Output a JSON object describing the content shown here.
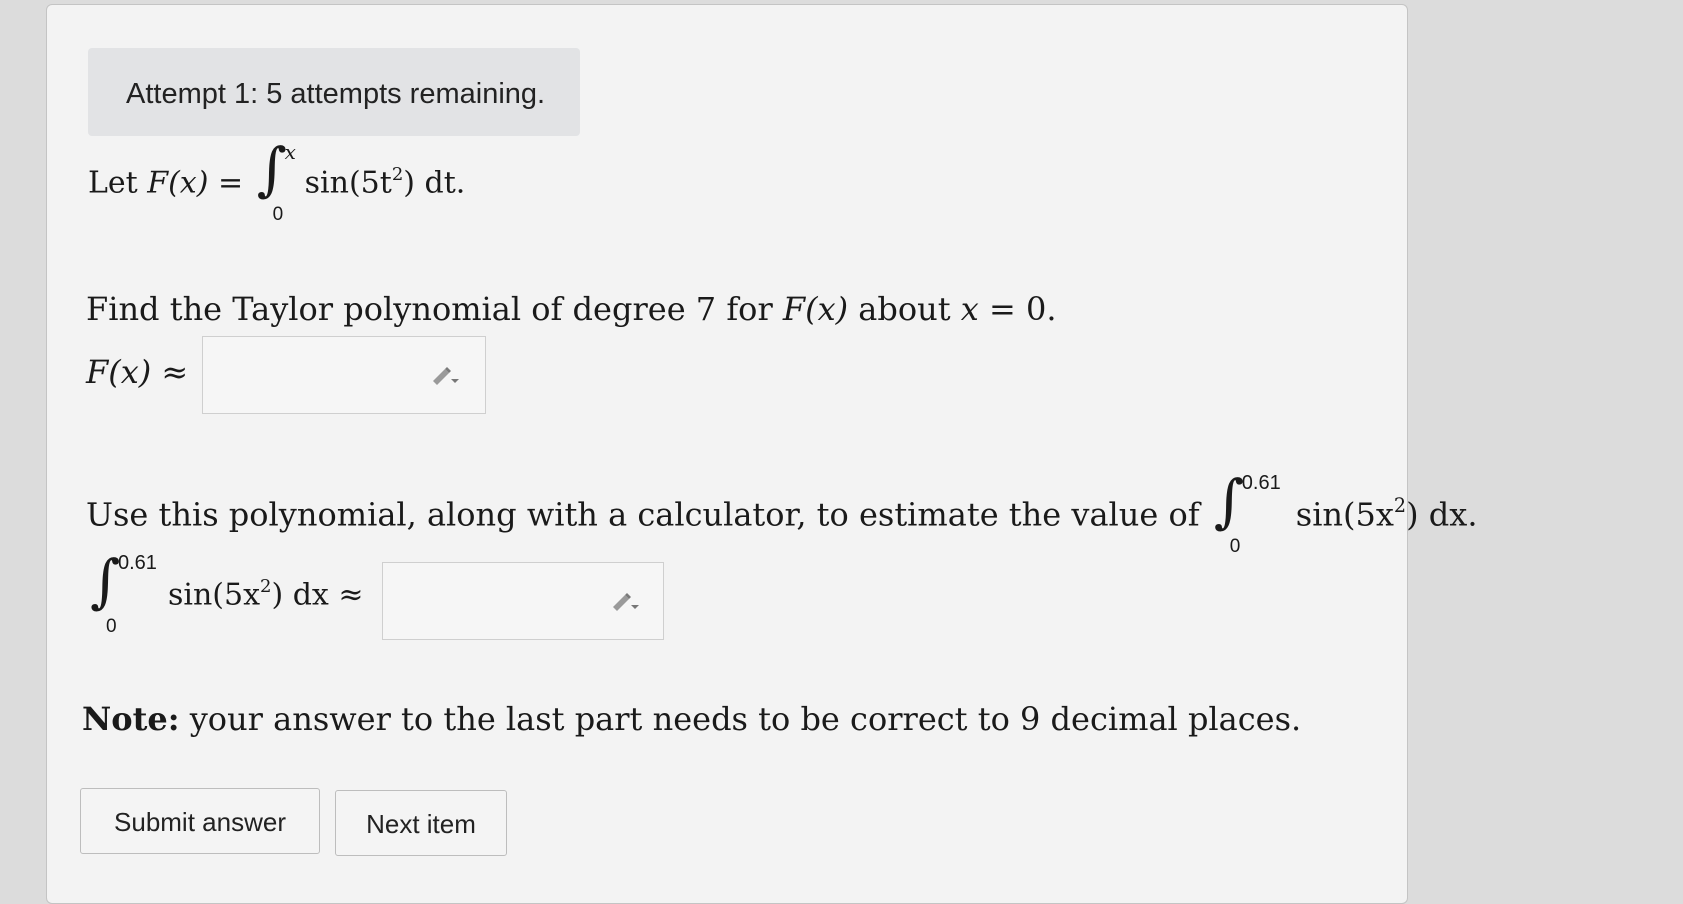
{
  "attempt": {
    "banner": "Attempt 1: 5 attempts remaining."
  },
  "problem": {
    "def_let": "Let ",
    "def_lhs": "F(x) = ",
    "def_upper": "x",
    "def_lower": "0",
    "def_integrand": "sin(5t",
    "def_exp": "2",
    "def_tail": ") dt.",
    "q1_text_a": "Find the Taylor polynomial of degree 7 for ",
    "q1_fx": "F(x)",
    "q1_text_b": " about ",
    "q1_var": "x",
    "q1_text_c": " = 0.",
    "q1_label": "F(x) ≈",
    "q1_answer": "",
    "q2_text": "Use this polynomial, along with a calculator, to estimate the value of ",
    "q2_upper": "0.61",
    "q2_lower": "0",
    "q2_integrand": "sin(5x",
    "q2_exp": "2",
    "q2_tail": ") dx.",
    "q2_label_upper": "0.61",
    "q2_label_lower": "0",
    "q2_label_integrand": "sin(5x",
    "q2_label_exp": "2",
    "q2_label_tail": ") dx ≈",
    "q2_answer": "",
    "note_bold": "Note:",
    "note_text": " your answer to the last part needs to be correct to 9 decimal places."
  },
  "icons": {
    "pencil_1": "pencil-icon",
    "pencil_2": "pencil-icon"
  },
  "buttons": {
    "submit": "Submit answer",
    "next": "Next item"
  }
}
